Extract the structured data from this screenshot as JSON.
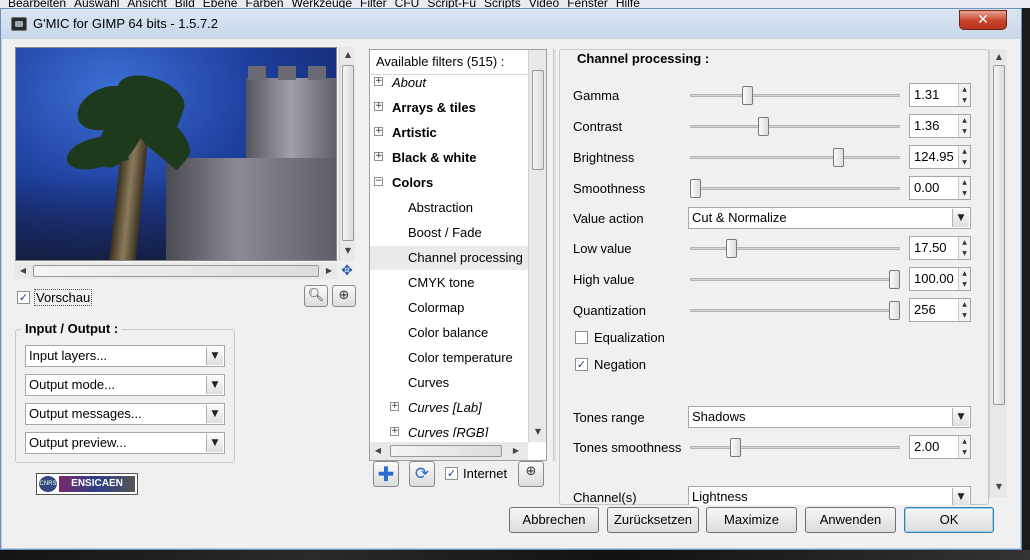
{
  "window": {
    "title": "G'MIC for GIMP 64 bits - 1.5.7.2",
    "close_label": "✕"
  },
  "background_menu": [
    "Bearbeiten",
    "Auswahl",
    "Ansicht",
    "Bild",
    "Ebene",
    "Farben",
    "Werkzeuge",
    "Filter",
    "CFU",
    "Script-Fu",
    "Scripts",
    "Video",
    "Fenster",
    "Hilfe"
  ],
  "preview": {
    "checkbox_label": "Vorschau",
    "checked": true
  },
  "input_output": {
    "title": "Input / Output :",
    "combos": [
      "Input layers...",
      "Output mode...",
      "Output messages...",
      "Output preview..."
    ]
  },
  "logo": {
    "left_text": "CNRS",
    "right_text": "ENSICAEN"
  },
  "filters": {
    "header": "Available filters (515) :",
    "items": [
      {
        "label": "About",
        "style": "italic",
        "expander": "+"
      },
      {
        "label": "Arrays & tiles",
        "style": "bold",
        "expander": "+"
      },
      {
        "label": "Artistic",
        "style": "bold",
        "expander": "+"
      },
      {
        "label": "Black & white",
        "style": "bold",
        "expander": "+"
      },
      {
        "label": "Colors",
        "style": "bold",
        "expander": "−"
      },
      {
        "label": "Abstraction",
        "style": "normal",
        "expander": ""
      },
      {
        "label": "Boost / Fade",
        "style": "normal",
        "expander": ""
      },
      {
        "label": "Channel processing",
        "style": "normal",
        "expander": ""
      },
      {
        "label": "CMYK tone",
        "style": "normal",
        "expander": ""
      },
      {
        "label": "Colormap",
        "style": "normal",
        "expander": ""
      },
      {
        "label": "Color balance",
        "style": "normal",
        "expander": ""
      },
      {
        "label": "Color temperature",
        "style": "normal",
        "expander": ""
      },
      {
        "label": "Curves",
        "style": "normal",
        "expander": ""
      },
      {
        "label": "Curves [Lab]",
        "style": "italic",
        "expander": "+"
      },
      {
        "label": "Curves [RGB]",
        "style": "italic",
        "expander": "+"
      }
    ],
    "internet_label": "Internet",
    "internet_checked": true
  },
  "params": {
    "title": "Channel processing :",
    "gamma": {
      "label": "Gamma",
      "value": "1.31",
      "fraction": 0.26
    },
    "contrast": {
      "label": "Contrast",
      "value": "1.36",
      "fraction": 0.34
    },
    "brightness": {
      "label": "Brightness",
      "value": "124.95",
      "fraction": 0.72
    },
    "smoothness": {
      "label": "Smoothness",
      "value": "0.00",
      "fraction": 0.0
    },
    "value_action": {
      "label": "Value action",
      "value": "Cut & Normalize"
    },
    "low_value": {
      "label": "Low value",
      "value": "17.50",
      "fraction": 0.18
    },
    "high_value": {
      "label": "High value",
      "value": "100.00",
      "fraction": 1.0
    },
    "quantization": {
      "label": "Quantization",
      "value": "256",
      "fraction": 1.0
    },
    "equalization": {
      "label": "Equalization",
      "checked": false
    },
    "negation": {
      "label": "Negation",
      "checked": true
    },
    "tones_range": {
      "label": "Tones range",
      "value": "Shadows"
    },
    "tones_smoothness": {
      "label": "Tones smoothness",
      "value": "2.00",
      "fraction": 0.2
    },
    "channels": {
      "label": "Channel(s)",
      "value": "Lightness"
    }
  },
  "buttons": {
    "cancel": "Abbrechen",
    "reset": "Zurücksetzen",
    "maximize": "Maximize",
    "apply": "Anwenden",
    "ok": "OK"
  }
}
